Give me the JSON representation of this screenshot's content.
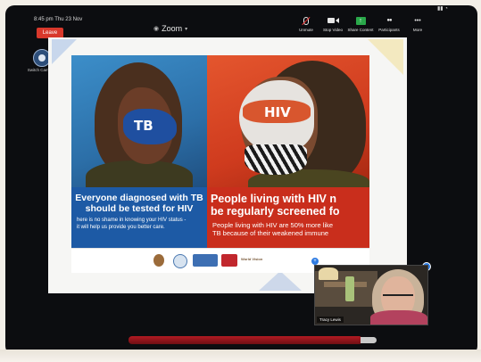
{
  "status_bar": {
    "time": "8:45 pm  Thu 23 Nov"
  },
  "toolbar": {
    "leave_label": "Leave",
    "app_title": "Zoom",
    "items": [
      {
        "label": "Unmute",
        "icon": "microphone-muted-icon"
      },
      {
        "label": "Stop Video",
        "icon": "video-camera-icon"
      },
      {
        "label": "Share Content",
        "icon": "share-screen-icon"
      },
      {
        "label": "Participants",
        "icon": "participants-icon"
      },
      {
        "label": "More",
        "icon": "more-dots-icon"
      }
    ]
  },
  "side_camera": {
    "label": "Switch Camera"
  },
  "slide": {
    "left_mask_text": "TB",
    "right_mask_text": "HIV",
    "left_headline": [
      "Everyone diagnosed with TB",
      "should be tested for HIV"
    ],
    "left_body": [
      "here is no shame in knowing your HIV status -",
      "it will help us provide you better care."
    ],
    "right_headline": [
      "People living with HIV n",
      "be regularly screened fo"
    ],
    "right_body": [
      "People living with HIV are 50% more like",
      "TB because of their weakened immune"
    ],
    "logos": [
      "",
      "",
      "",
      "",
      "World Vision"
    ]
  },
  "self_view": {
    "name": "Tracy Lewis"
  },
  "colors": {
    "accent_leave": "#d8382b",
    "share_green": "#2aa84a",
    "tb_blue": "#1d5aa5",
    "hiv_red": "#c92e1c",
    "badge_blue": "#2d7be3"
  }
}
